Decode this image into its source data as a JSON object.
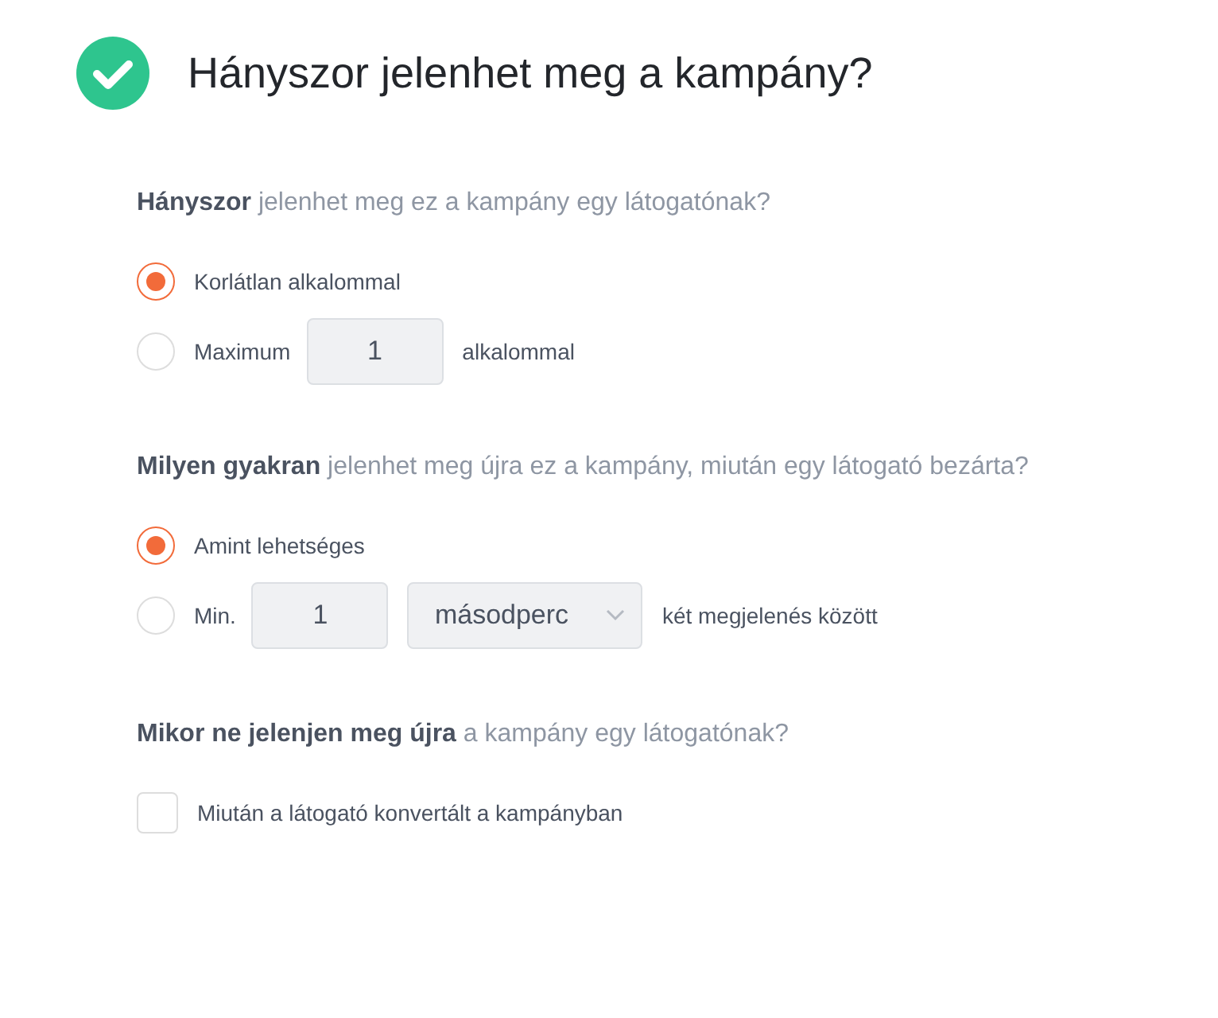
{
  "header": {
    "title": "Hányszor jelenhet meg a kampány?",
    "completed": true
  },
  "sections": [
    {
      "question": "**Hányszor** jelenhet meg ez a kampány egy látogatónak?",
      "options": [
        {
          "kind": "radio",
          "selected": true,
          "label": "Korlátlan alkalommal"
        },
        {
          "kind": "radio",
          "selected": false,
          "label": "Maximum",
          "value": "1",
          "suffix": "alkalommal"
        }
      ]
    },
    {
      "question": "**Milyen gyakran** jelenhet meg újra ez a kampány, miután egy látogató bezárta?",
      "options": [
        {
          "kind": "radio",
          "selected": true,
          "label": "Amint lehetséges"
        },
        {
          "kind": "radio",
          "selected": false,
          "label": "Min.",
          "value": "1",
          "unit": "másodperc",
          "suffix": "két megjelenés között"
        }
      ]
    },
    {
      "question": "**Mikor ne jelenjen meg újra** a kampány egy látogatónak?",
      "options": [
        {
          "kind": "checkbox",
          "checked": false,
          "label": "Miután a látogató konvertált a kampányban"
        }
      ]
    }
  ]
}
